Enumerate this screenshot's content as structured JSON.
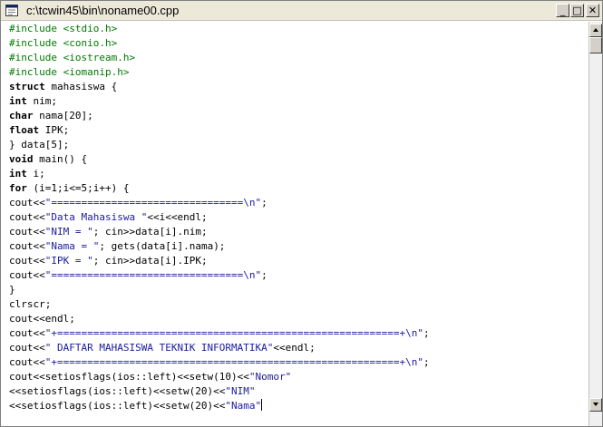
{
  "window": {
    "title": "c:\\tcwin45\\bin\\noname00.cpp",
    "minimize_glyph": "_",
    "maximize_glyph": "□",
    "close_glyph": "✕"
  },
  "code_lines": [
    [
      {
        "t": "pre",
        "v": "#include <stdio.h>"
      }
    ],
    [
      {
        "t": "pre",
        "v": "#include <conio.h>"
      }
    ],
    [
      {
        "t": "pre",
        "v": "#include <iostream.h>"
      }
    ],
    [
      {
        "t": "pre",
        "v": "#include <iomanip.h>"
      }
    ],
    [
      {
        "t": "kw",
        "v": "struct"
      },
      {
        "t": "plain",
        "v": " mahasiswa {"
      }
    ],
    [
      {
        "t": "kw",
        "v": "int"
      },
      {
        "t": "plain",
        "v": " nim;"
      }
    ],
    [
      {
        "t": "kw",
        "v": "char"
      },
      {
        "t": "plain",
        "v": " nama[20];"
      }
    ],
    [
      {
        "t": "kw",
        "v": "float"
      },
      {
        "t": "plain",
        "v": " IPK;"
      }
    ],
    [
      {
        "t": "plain",
        "v": "} data[5];"
      }
    ],
    [
      {
        "t": "kw",
        "v": "void"
      },
      {
        "t": "plain",
        "v": " main() {"
      }
    ],
    [
      {
        "t": "kw",
        "v": "int"
      },
      {
        "t": "plain",
        "v": " i;"
      }
    ],
    [
      {
        "t": "kw",
        "v": "for"
      },
      {
        "t": "plain",
        "v": " (i=1;i<=5;i++) {"
      }
    ],
    [
      {
        "t": "plain",
        "v": "cout<<"
      },
      {
        "t": "str",
        "v": "\"================================\\n\""
      },
      {
        "t": "plain",
        "v": ";"
      }
    ],
    [
      {
        "t": "plain",
        "v": "cout<<"
      },
      {
        "t": "str",
        "v": "\"Data Mahasiswa \""
      },
      {
        "t": "plain",
        "v": "<<i<<endl;"
      }
    ],
    [
      {
        "t": "plain",
        "v": "cout<<"
      },
      {
        "t": "str",
        "v": "\"NIM = \""
      },
      {
        "t": "plain",
        "v": "; cin>>data[i].nim;"
      }
    ],
    [
      {
        "t": "plain",
        "v": "cout<<"
      },
      {
        "t": "str",
        "v": "\"Nama = \""
      },
      {
        "t": "plain",
        "v": "; gets(data[i].nama);"
      }
    ],
    [
      {
        "t": "plain",
        "v": "cout<<"
      },
      {
        "t": "str",
        "v": "\"IPK = \""
      },
      {
        "t": "plain",
        "v": "; cin>>data[i].IPK;"
      }
    ],
    [
      {
        "t": "plain",
        "v": "cout<<"
      },
      {
        "t": "str",
        "v": "\"================================\\n\""
      },
      {
        "t": "plain",
        "v": ";"
      }
    ],
    [
      {
        "t": "plain",
        "v": "}"
      }
    ],
    [
      {
        "t": "plain",
        "v": "clrscr;"
      }
    ],
    [
      {
        "t": "plain",
        "v": "cout<<endl;"
      }
    ],
    [
      {
        "t": "plain",
        "v": "cout<<"
      },
      {
        "t": "str",
        "v": "\"+=========================================================+\\n\""
      },
      {
        "t": "plain",
        "v": ";"
      }
    ],
    [
      {
        "t": "plain",
        "v": "cout<<"
      },
      {
        "t": "str",
        "v": "\" DAFTAR MAHASISWA TEKNIK INFORMATIKA\""
      },
      {
        "t": "plain",
        "v": "<<endl;"
      }
    ],
    [
      {
        "t": "plain",
        "v": "cout<<"
      },
      {
        "t": "str",
        "v": "\"+=========================================================+\\n\""
      },
      {
        "t": "plain",
        "v": ";"
      }
    ],
    [
      {
        "t": "plain",
        "v": "cout<<setiosflags(ios::left)<<setw(10)<<"
      },
      {
        "t": "str",
        "v": "\"Nomor\""
      }
    ],
    [
      {
        "t": "plain",
        "v": "<<setiosflags(ios::left)<<setw(20)<<"
      },
      {
        "t": "str",
        "v": "\"NIM\""
      }
    ],
    [
      {
        "t": "plain",
        "v": "<<setiosflags(ios::left)<<setw(20)<<"
      },
      {
        "t": "str",
        "v": "\"Nama\""
      },
      {
        "t": "caret",
        "v": ""
      }
    ]
  ],
  "colors": {
    "preprocessor": "#007a00",
    "string": "#1a1aa0",
    "keyword": "#000000",
    "plain": "#000000"
  }
}
